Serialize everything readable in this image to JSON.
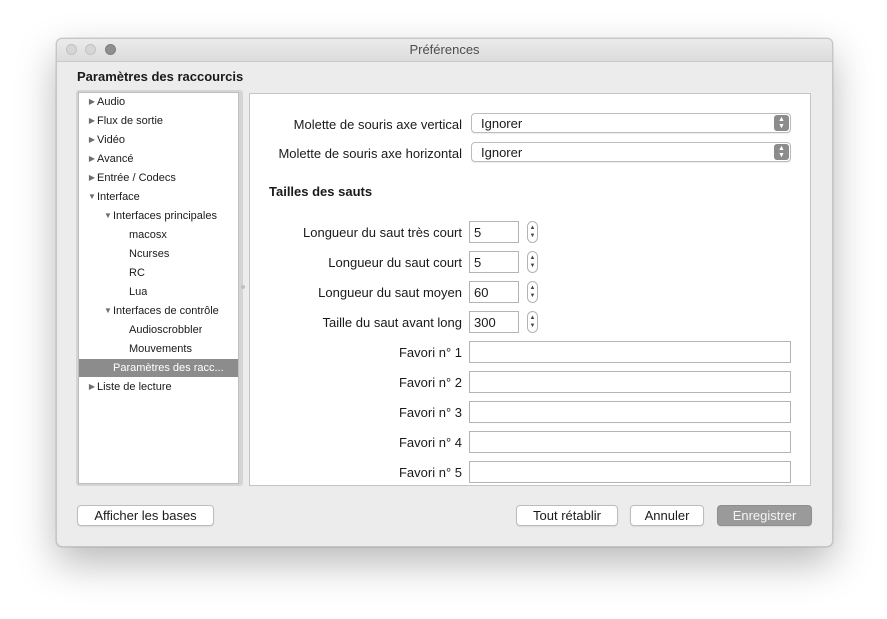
{
  "window": {
    "title": "Préférences"
  },
  "section_title": "Paramètres des raccourcis",
  "tree": [
    {
      "label": "Audio",
      "disclosure": "▶",
      "level": 0
    },
    {
      "label": "Flux de sortie",
      "disclosure": "▶",
      "level": 0
    },
    {
      "label": "Vidéo",
      "disclosure": "▶",
      "level": 0
    },
    {
      "label": "Avancé",
      "disclosure": "▶",
      "level": 0
    },
    {
      "label": "Entrée / Codecs",
      "disclosure": "▶",
      "level": 0
    },
    {
      "label": "Interface",
      "disclosure": "▼",
      "level": 0
    },
    {
      "label": "Interfaces principales",
      "disclosure": "▼",
      "level": 1
    },
    {
      "label": "macosx",
      "disclosure": "",
      "level": 2
    },
    {
      "label": "Ncurses",
      "disclosure": "",
      "level": 2
    },
    {
      "label": "RC",
      "disclosure": "",
      "level": 2
    },
    {
      "label": "Lua",
      "disclosure": "",
      "level": 2
    },
    {
      "label": "Interfaces de contrôle",
      "disclosure": "▼",
      "level": 1
    },
    {
      "label": "Audioscrobbler",
      "disclosure": "",
      "level": 2
    },
    {
      "label": "Mouvements",
      "disclosure": "",
      "level": 2
    },
    {
      "label": "Paramètres des racc...",
      "disclosure": "",
      "level": 1,
      "selected": true
    },
    {
      "label": "Liste de lecture",
      "disclosure": "▶",
      "level": 0
    }
  ],
  "content": {
    "mouse_wheel_vertical": {
      "label": "Molette de souris axe vertical",
      "value": "Ignorer"
    },
    "mouse_wheel_horizontal": {
      "label": "Molette de souris axe horizontal",
      "value": "Ignorer"
    },
    "jump_sizes_heading": "Tailles des sauts",
    "jumps": [
      {
        "label": "Longueur du saut très court",
        "value": "5"
      },
      {
        "label": "Longueur du saut court",
        "value": "5"
      },
      {
        "label": "Longueur du saut moyen",
        "value": "60"
      },
      {
        "label": "Taille du saut avant long",
        "value": "300"
      }
    ],
    "favorites": [
      {
        "label": "Favori n° 1",
        "value": ""
      },
      {
        "label": "Favori n° 2",
        "value": ""
      },
      {
        "label": "Favori n° 3",
        "value": ""
      },
      {
        "label": "Favori n° 4",
        "value": ""
      },
      {
        "label": "Favori n° 5",
        "value": ""
      }
    ]
  },
  "buttons": {
    "show_basic": "Afficher les bases",
    "reset_all": "Tout rétablir",
    "cancel": "Annuler",
    "save": "Enregistrer"
  },
  "icons": {
    "collapsed": "disclosure-triangle-right-icon",
    "expanded": "disclosure-triangle-down-icon",
    "popup": "popup-arrows-icon",
    "stepper": "stepper-arrows-icon"
  }
}
